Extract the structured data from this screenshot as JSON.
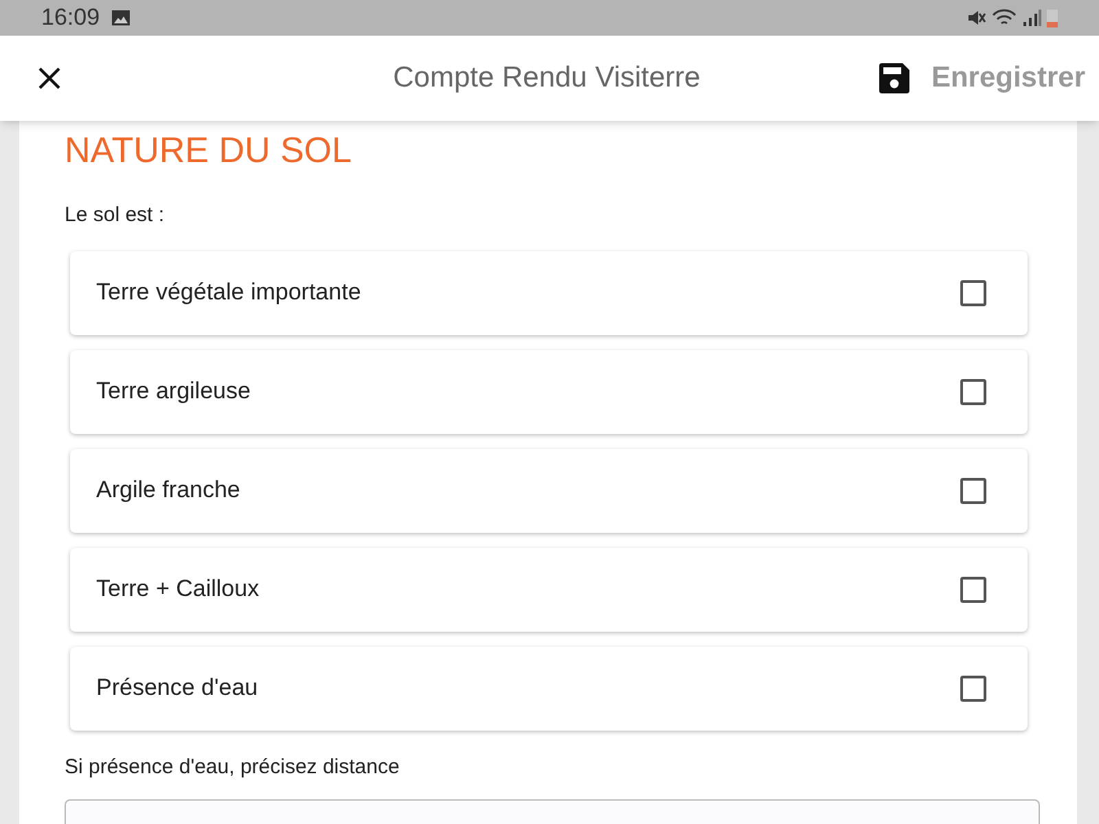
{
  "status_bar": {
    "time": "16:09"
  },
  "app_bar": {
    "title": "Compte Rendu Visiterre",
    "save_label": "Enregistrer"
  },
  "section": {
    "title": "NATURE DU SOL",
    "question": "Le sol est :",
    "options": [
      {
        "label": "Terre végétale importante",
        "checked": false
      },
      {
        "label": "Terre argileuse",
        "checked": false
      },
      {
        "label": "Argile franche",
        "checked": false
      },
      {
        "label": "Terre + Cailloux",
        "checked": false
      },
      {
        "label": "Présence d'eau",
        "checked": false
      }
    ],
    "distance_label": "Si présence d'eau, précisez distance"
  }
}
